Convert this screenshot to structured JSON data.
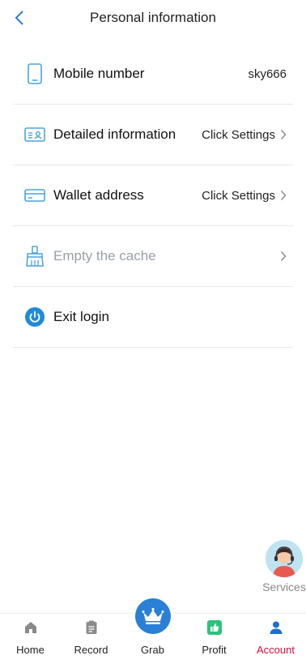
{
  "header": {
    "title": "Personal information"
  },
  "rows": [
    {
      "label": "Mobile number",
      "value": "sky666"
    },
    {
      "label": "Detailed information",
      "value": "Click Settings"
    },
    {
      "label": "Wallet address",
      "value": "Click Settings"
    },
    {
      "label": "Empty the cache",
      "value": ""
    },
    {
      "label": "Exit login"
    }
  ],
  "service": {
    "label": "Services"
  },
  "tabs": [
    {
      "label": "Home",
      "icon": "home-icon"
    },
    {
      "label": "Record",
      "icon": "clipboard-icon"
    },
    {
      "label": "Grab",
      "icon": "crown-icon"
    },
    {
      "label": "Profit",
      "icon": "thumbs-up-icon"
    },
    {
      "label": "Account",
      "icon": "user-icon",
      "active": true
    }
  ],
  "colors": {
    "accent": "#2a7fd6",
    "icon_blue": "#4aa3df",
    "active_tab": "#d0103a",
    "profit_green": "#2bc37a"
  }
}
